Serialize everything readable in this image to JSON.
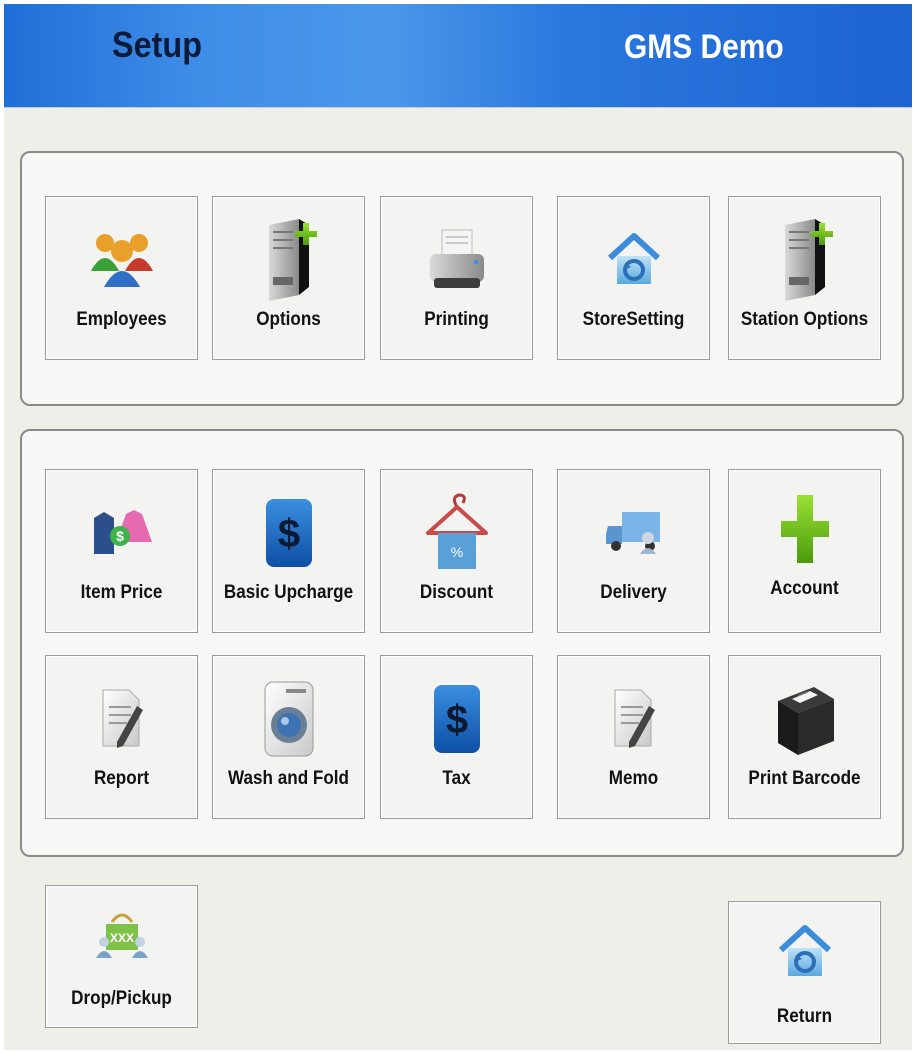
{
  "header": {
    "title": "Setup",
    "store_name": "GMS Demo"
  },
  "setup_group": [
    {
      "label": "Employees",
      "icon": "employees-icon"
    },
    {
      "label": "Options",
      "icon": "server-add-icon"
    },
    {
      "label": "Printing",
      "icon": "printer-icon"
    },
    {
      "label": "StoreSetting",
      "icon": "store-home-icon"
    },
    {
      "label": "Station Options",
      "icon": "server-add-icon"
    }
  ],
  "pricing_group": [
    {
      "label": "Item Price",
      "icon": "item-price-icon"
    },
    {
      "label": "Basic Upcharge",
      "icon": "dollar-icon"
    },
    {
      "label": "Discount",
      "icon": "hanger-discount-icon"
    },
    {
      "label": "Delivery",
      "icon": "delivery-truck-icon"
    },
    {
      "label": "Account",
      "icon": "plus-icon"
    },
    {
      "label": "Report",
      "icon": "report-document-icon"
    },
    {
      "label": "Wash and Fold",
      "icon": "washing-machine-icon"
    },
    {
      "label": "Tax",
      "icon": "dollar-icon"
    },
    {
      "label": "Memo",
      "icon": "memo-document-icon"
    },
    {
      "label": "Print Barcode",
      "icon": "receipt-printer-icon"
    }
  ],
  "footer": {
    "drop_pickup_label": "Drop/Pickup",
    "return_label": "Return"
  },
  "colors": {
    "header_gradient": [
      "#1f6fd8",
      "#4a97ea",
      "#1d63d2"
    ],
    "background": "#efefe9",
    "tile": "#f3f3f1",
    "title_text": "#0d1b3a",
    "store_text": "#ffffff"
  }
}
